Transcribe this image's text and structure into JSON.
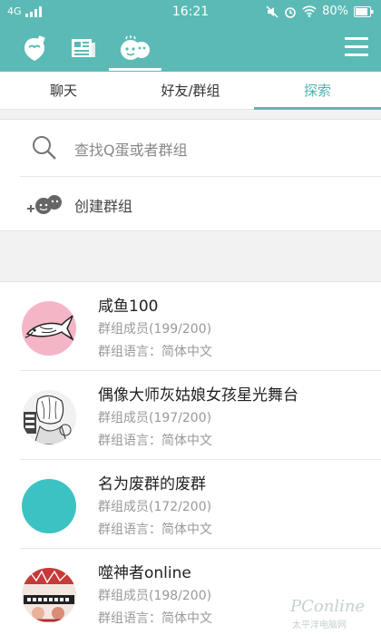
{
  "status_bar": {
    "network": "4G",
    "time": "16:21",
    "battery": "80%",
    "icons": [
      "signal-icon",
      "mute-icon",
      "alarm-icon",
      "wifi-icon",
      "battery-icon"
    ]
  },
  "top_bar": {
    "icons": [
      "profile-icon",
      "news-icon",
      "explore-icon",
      "menu-icon"
    ],
    "active": "explore-icon",
    "color": "#5bbab5"
  },
  "tabs": [
    {
      "label": "聊天"
    },
    {
      "label": "好友/群组"
    },
    {
      "label": "探索"
    }
  ],
  "active_tab": 2,
  "actions": {
    "search_placeholder": "查找Q蛋或者群组",
    "create_group": "创建群组"
  },
  "groups": [
    {
      "name": "咸鱼100",
      "members": "群组成员(199/200)",
      "language": "群组语言：简体中文",
      "avatar": "fish-illustration-avatar"
    },
    {
      "name": "偶像大师灰姑娘女孩星光舞台",
      "members": "群组成员(197/200)",
      "language": "群组语言：简体中文",
      "avatar": "manga-avatar"
    },
    {
      "name": "名为废群的废群",
      "members": "群组成员(172/200)",
      "language": "群组语言：简体中文",
      "avatar": "teal-circle-avatar"
    },
    {
      "name": "噬神者online",
      "members": "群组成员(198/200)",
      "language": "群组语言：简体中文",
      "avatar": "anime-poster-avatar"
    }
  ],
  "watermark": {
    "line1": "PConline",
    "line2": "太平洋电脑网"
  }
}
